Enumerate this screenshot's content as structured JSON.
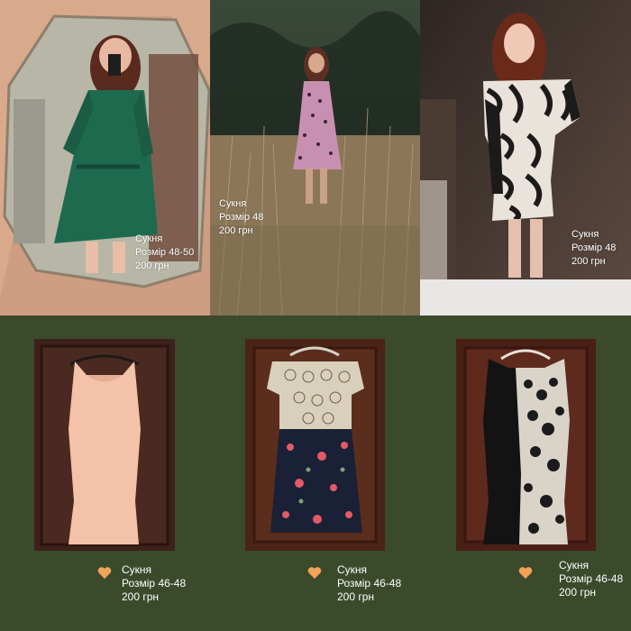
{
  "collage": {
    "background": "#3a4a2b",
    "photos": [
      {
        "name": "green-dress-mirror-photo",
        "caption": [
          "Сукня",
          "Розмір 48-50",
          "200 грн"
        ]
      },
      {
        "name": "pink-polka-dot-dress-field-photo",
        "caption": [
          "Сукня",
          "Розмір 48",
          "200 грн"
        ]
      },
      {
        "name": "zebra-print-dress-photo",
        "caption": [
          "Сукня",
          "Розмір 48",
          "200 грн"
        ]
      },
      {
        "name": "peach-bodycon-dress-hanger-photo",
        "caption": [
          "Сукня",
          "Розмір 46-48",
          "200 грн"
        ],
        "icon": "orange-heart-icon"
      },
      {
        "name": "crochet-floral-dress-hanger-photo",
        "caption": [
          "Сукня",
          "Розмір 46-48",
          "200 грн"
        ],
        "icon": "orange-heart-icon"
      },
      {
        "name": "black-lace-dress-hanger-photo",
        "caption": [
          "Сукня",
          "Розмір 46-48",
          "200 грн"
        ],
        "icon": "orange-heart-icon"
      }
    ],
    "heart_color": "#f2a35a"
  }
}
